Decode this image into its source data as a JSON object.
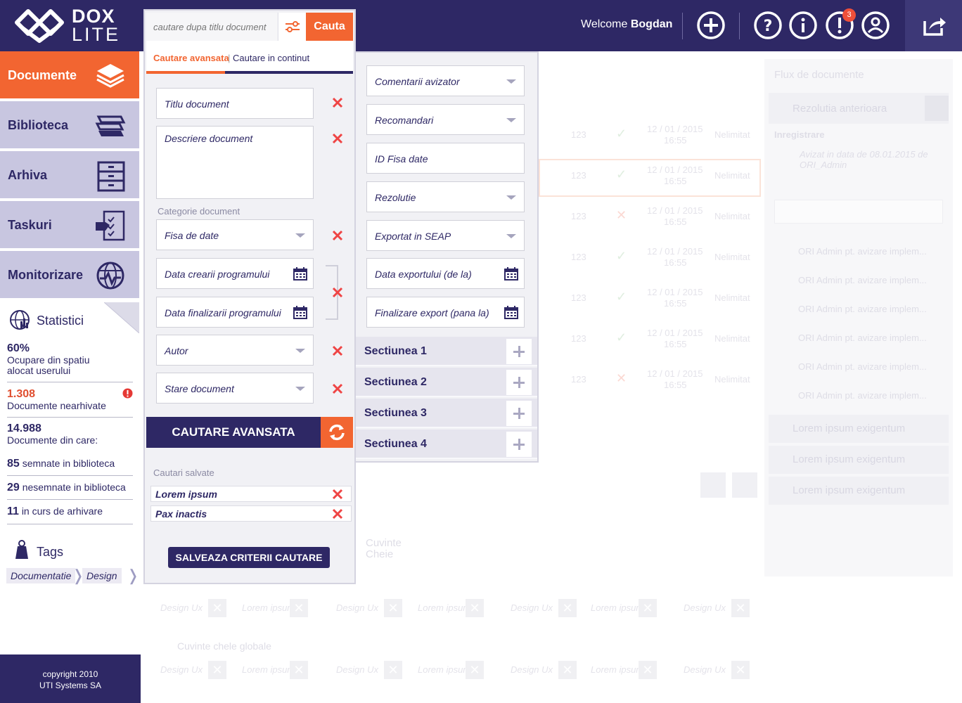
{
  "header": {
    "logo_line1": "DOX",
    "logo_line2": "LITE",
    "welcome_prefix": "Welcome",
    "user_name": "Bogdan",
    "notification_count": "3",
    "icons": [
      "plus-circle-icon",
      "help-icon",
      "info-icon",
      "alert-icon",
      "user-icon",
      "exit-icon"
    ]
  },
  "sidebar": {
    "items": [
      {
        "label": "Documente",
        "icon": "layers-icon"
      },
      {
        "label": "Biblioteca",
        "icon": "books-icon"
      },
      {
        "label": "Arhiva",
        "icon": "cabinet-icon"
      },
      {
        "label": "Taskuri",
        "icon": "checklist-icon"
      },
      {
        "label": "Monitorizare",
        "icon": "globe-monitor-icon"
      }
    ],
    "stats_title": "Statistici",
    "stats": {
      "usage_value": "60%",
      "usage_label": "Ocupare din spatiu alocat userului",
      "unarchived_value": "1.308",
      "unarchived_label": "Documente nearhivate",
      "total_value": "14.988",
      "total_label": "Documente din care:",
      "signed_value": "85",
      "signed_label": "semnate in biblioteca",
      "unsigned_value": "29",
      "unsigned_label": "nesemnate in biblioteca",
      "archiving_value": "11",
      "archiving_label": "in curs de arhivare"
    },
    "tags_title": "Tags",
    "tags": [
      "Documentatie",
      "Design"
    ],
    "footer_line1": "copyright 2010",
    "footer_line2": "UTI Systems SA"
  },
  "search": {
    "placeholder": "cautare dupa titlu document",
    "button_label": "Cauta",
    "tab_advanced": "Cautare avansata",
    "tab_separator": "|",
    "tab_content": "Cautare in continut",
    "fields": {
      "title": "Titlu document",
      "description": "Descriere document",
      "category_label": "Categorie document",
      "category_value": "Fisa de date",
      "created_date": "Data crearii programului",
      "finished_date": "Data finalizarii programului",
      "author": "Autor",
      "status": "Stare document"
    },
    "right_fields": {
      "comments": "Comentarii avizator",
      "recommendations": "Recomandari",
      "data_sheet_id": "ID Fisa date",
      "resolution": "Rezolutie",
      "exported_seap": "Exportat in SEAP",
      "export_from": "Data exportului (de la)",
      "export_to": "Finalizare export (pana la)"
    },
    "sections": [
      "Sectiunea 1",
      "Sectiunea 2",
      "Sectiunea 3",
      "Sectiunea 4"
    ],
    "advanced_button": "CAUTARE AVANSATA",
    "saved_label": "Cautari salvate",
    "saved_searches": [
      "Lorem ipsum",
      "Pax inactis"
    ],
    "save_criteria_button": "SALVEAZA CRITERII CAUTARE"
  },
  "background": {
    "panel_title": "Flux de documente",
    "resolution_title": "Rezolutia anterioara",
    "registration": "Inregistrare",
    "approved_note": "Avizat in data de 08.01.2015 de ORI_Admin",
    "rows": [
      {
        "num": "123",
        "date": "12 / 01 / 2015",
        "time": "16:55",
        "status": "Nelimitat"
      },
      {
        "num": "123",
        "date": "12 / 01 / 2015",
        "time": "16:55",
        "status": "Nelimitat"
      },
      {
        "num": "123",
        "date": "12 / 01 / 2015",
        "time": "16:55",
        "status": "Nelimitat"
      },
      {
        "num": "123",
        "date": "12 / 01 / 2015",
        "time": "16:55",
        "status": "Nelimitat"
      },
      {
        "num": "123",
        "date": "12 / 01 / 2015",
        "time": "16:55",
        "status": "Nelimitat"
      },
      {
        "num": "123",
        "date": "12 / 01 / 2015",
        "time": "16:55",
        "status": "Nelimitat"
      },
      {
        "num": "123",
        "date": "12 / 01 / 2015",
        "time": "16:55",
        "status": "Nelimitat"
      }
    ],
    "flow_items": [
      "ORI Admin pt. avizare implem...",
      "ORI Admin pt. avizare implem...",
      "ORI Admin pt. avizare implem...",
      "ORI Admin pt. avizare implem...",
      "ORI Admin pt. avizare implem...",
      "ORI Admin pt. avizare implem..."
    ],
    "accordions": [
      "Lorem ipsum exigentum",
      "Lorem ipsum exigentum",
      "Lorem ipsum exigentum"
    ],
    "keywords_label": "Cuvinte Cheie",
    "keywords_global": "Cuvinte chele globale",
    "keyword_tags": [
      "Design Ux",
      "Lorem ipsum",
      "Design Ux",
      "Lorem ipsum",
      "Design Ux",
      "Lorem ipsum",
      "Design Ux"
    ]
  },
  "colors": {
    "navy": "#2e2865",
    "orange": "#f26531",
    "red_x": "#ef4444",
    "lavender": "#c8c6e0"
  }
}
